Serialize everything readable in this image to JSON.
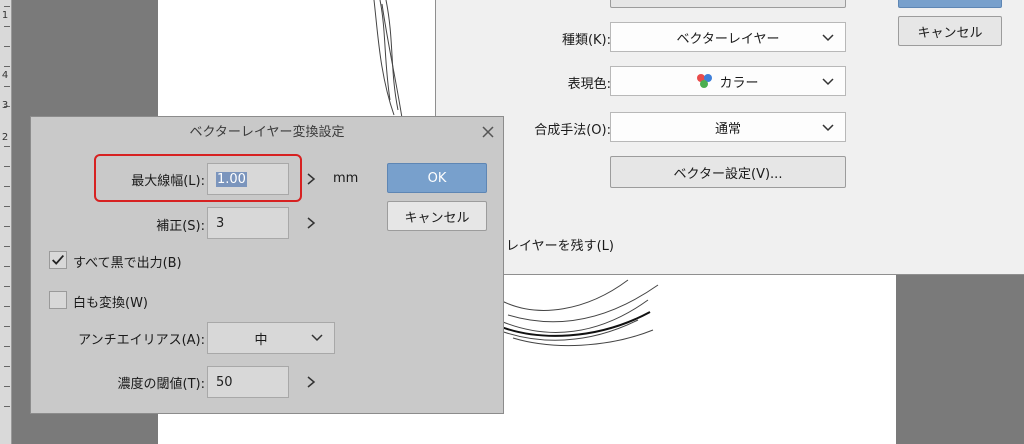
{
  "ruler": {
    "numbers": [
      "1",
      "4",
      "3",
      "2"
    ]
  },
  "layer_dialog": {
    "cancel_label": "キャンセル",
    "kind": {
      "label": "種類(K):",
      "value": "ベクターレイヤー"
    },
    "color": {
      "label": "表現色:",
      "value": "カラー"
    },
    "blend": {
      "label": "合成手法(O):",
      "value": "通常"
    },
    "vector_settings_label": "ベクター設定(V)...",
    "keep_layer_label": "レイヤーを残す(L)"
  },
  "conv_dialog": {
    "title": "ベクターレイヤー変換設定",
    "max_width": {
      "label": "最大線幅(L):",
      "value": "1.00",
      "unit": "mm"
    },
    "correction": {
      "label": "補正(S):",
      "value": "3"
    },
    "all_black": {
      "label": "すべて黒で出力(B)",
      "checked": true
    },
    "white_convert": {
      "label": "白も変換(W)",
      "checked": false
    },
    "antialias": {
      "label": "アンチエイリアス(A):",
      "value": "中"
    },
    "density_threshold": {
      "label": "濃度の閾値(T):",
      "value": "50"
    },
    "ok_label": "OK",
    "cancel_label": "キャンセル"
  },
  "colors": {
    "ok_button": "#78a0cc",
    "highlight_box": "#d72121",
    "dots": [
      "#e94b4b",
      "#4caf50",
      "#3f7fd9"
    ]
  }
}
